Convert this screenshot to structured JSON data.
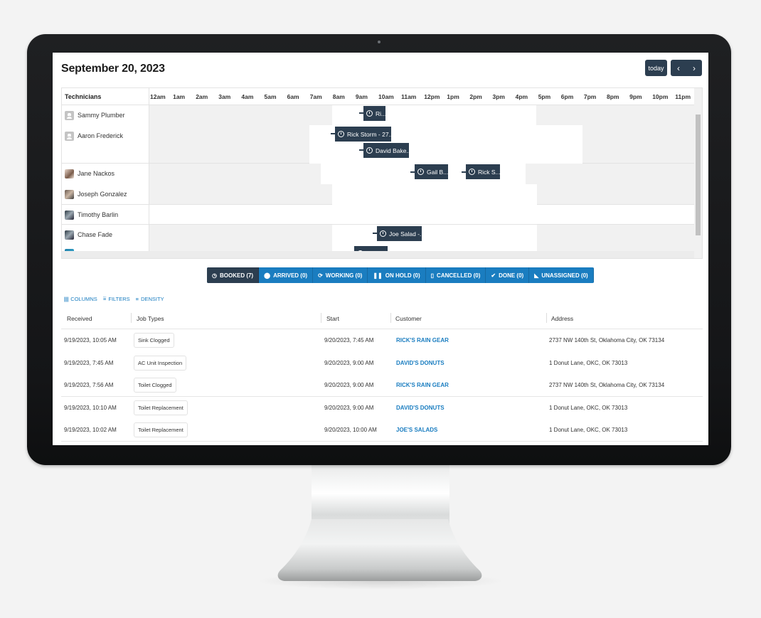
{
  "header": {
    "title": "September 20, 2023",
    "today_label": "today",
    "prev_icon": "‹",
    "next_icon": "›"
  },
  "scheduler": {
    "resource_header": "Technicians",
    "hours": [
      "12am",
      "1am",
      "2am",
      "3am",
      "4am",
      "5am",
      "6am",
      "7am",
      "8am",
      "9am",
      "10am",
      "11am",
      "12pm",
      "1pm",
      "2pm",
      "3pm",
      "4pm",
      "5pm",
      "6pm",
      "7pm",
      "8pm",
      "9pm",
      "10pm",
      "11pm"
    ],
    "technicians": [
      {
        "name": "Sammy Plumber",
        "avatar": "generic-avatar"
      },
      {
        "name": "Aaron Frederick",
        "avatar": "generic-avatar"
      },
      {
        "name": "Jane Nackos",
        "avatar": "photo-avatar"
      },
      {
        "name": "Joseph Gonzalez",
        "avatar": "photo-avatar"
      },
      {
        "name": "Timothy Barlin",
        "avatar": "photo-avatar"
      },
      {
        "name": "Chase Fade",
        "avatar": "photo-avatar"
      }
    ],
    "events": [
      {
        "label": "Ri...",
        "technician": "Sammy Plumber",
        "icon": "clock-icon"
      },
      {
        "label": "Rick Storm - 27...",
        "technician": "Aaron Frederick",
        "icon": "clock-icon"
      },
      {
        "label": "David Bake...",
        "technician": "Aaron Frederick",
        "icon": "clock-icon"
      },
      {
        "label": "Gail B...",
        "technician": "Jane Nackos",
        "icon": "clock-icon"
      },
      {
        "label": "Rick S...",
        "technician": "Jane Nackos",
        "icon": "clock-icon"
      },
      {
        "label": "Joe Salad -...",
        "technician": "Chase Fade",
        "icon": "clock-icon"
      },
      {
        "label": "David...",
        "technician": "",
        "icon": "clock-icon"
      }
    ]
  },
  "status_tabs": [
    {
      "label": "BOOKED (7)",
      "icon": "clock-icon",
      "glyph": "◷",
      "active": true
    },
    {
      "label": "ARRIVED (0)",
      "icon": "map-pin-icon",
      "glyph": "⬤",
      "active": false
    },
    {
      "label": "WORKING (0)",
      "icon": "sync-icon",
      "glyph": "⟳",
      "active": false
    },
    {
      "label": "ON HOLD (0)",
      "icon": "pause-icon",
      "glyph": "❚❚",
      "active": false
    },
    {
      "label": "CANCELLED (0)",
      "icon": "trash-icon",
      "glyph": "▯",
      "active": false
    },
    {
      "label": "DONE (0)",
      "icon": "check-circle-icon",
      "glyph": "✔",
      "active": false
    },
    {
      "label": "UNASSIGNED (0)",
      "icon": "tag-off-icon",
      "glyph": "◣",
      "active": false
    }
  ],
  "grid_toolbar": {
    "columns_label": "COLUMNS",
    "filters_label": "FILTERS",
    "density_label": "DENSITY"
  },
  "table": {
    "columns": [
      "Received",
      "Job Types",
      "Start",
      "Customer",
      "Address"
    ],
    "rows": [
      {
        "received": "9/19/2023, 10:05 AM",
        "job_type": "Sink Clogged",
        "start": "9/20/2023, 7:45 AM",
        "customer": "RICK'S RAIN GEAR",
        "address": "2737 NW 140th St, Oklahoma City, OK 73134"
      },
      {
        "received": "9/19/2023, 7:45 AM",
        "job_type": "AC Unit Inspection",
        "start": "9/20/2023, 9:00 AM",
        "customer": "DAVID'S DONUTS",
        "address": "1 Donut Lane, OKC, OK 73013"
      },
      {
        "received": "9/19/2023, 7:56 AM",
        "job_type": "Toilet Clogged",
        "start": "9/20/2023, 9:00 AM",
        "customer": "RICK'S RAIN GEAR",
        "address": "2737 NW 140th St, Oklahoma City, OK 73134"
      },
      {
        "received": "9/19/2023, 10:10 AM",
        "job_type": "Toilet Replacement",
        "start": "9/20/2023, 9:00 AM",
        "customer": "DAVID'S DONUTS",
        "address": "1 Donut Lane, OKC, OK 73013"
      },
      {
        "received": "9/19/2023, 10:02 AM",
        "job_type": "Toilet Replacement",
        "start": "9/20/2023, 10:00 AM",
        "customer": "JOE'S SALADS",
        "address": "1 Donut Lane, OKC, OK 73013"
      }
    ]
  }
}
